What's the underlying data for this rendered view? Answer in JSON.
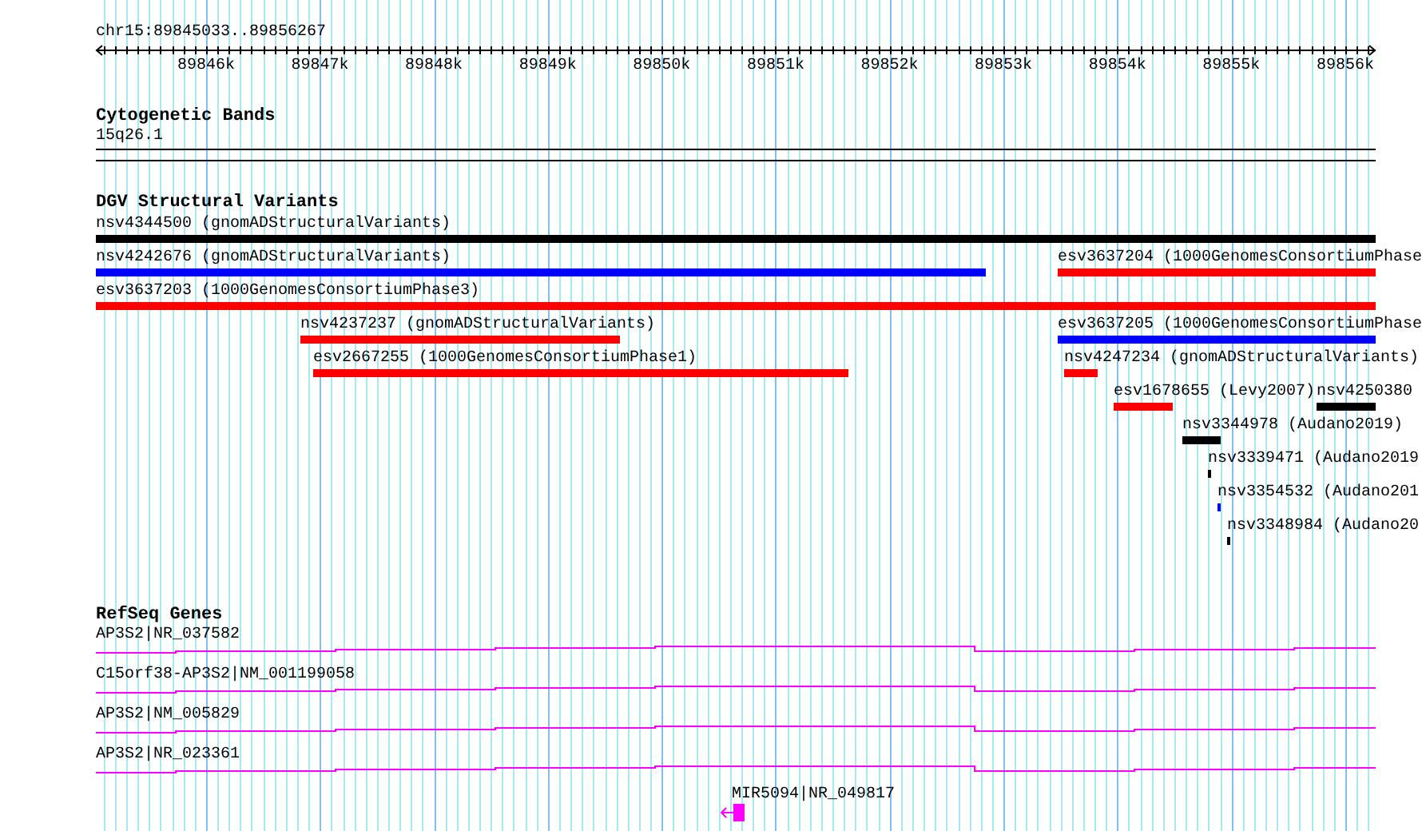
{
  "ruler": {
    "location": "chr15:89845033..89856267",
    "ticks": [
      {
        "label": "89846k"
      },
      {
        "label": "89847k"
      },
      {
        "label": "89848k"
      },
      {
        "label": "89849k"
      },
      {
        "label": "89850k"
      },
      {
        "label": "89851k"
      },
      {
        "label": "89852k"
      },
      {
        "label": "89853k"
      },
      {
        "label": "89854k"
      },
      {
        "label": "89855k"
      },
      {
        "label": "89856k"
      }
    ]
  },
  "cytogenetic_bands": {
    "title": "Cytogenetic Bands",
    "band": {
      "label": "15q26.1"
    }
  },
  "dgv_structural_variants": {
    "title": "DGV Structural Variants",
    "rows": [
      [
        {
          "label": "nsv4344500 (gnomADStructuralVariants)",
          "color": "#000000"
        }
      ],
      [
        {
          "label": "nsv4242676 (gnomADStructuralVariants)",
          "color": "#0000ff"
        },
        {
          "label": "esv3637204 (1000GenomesConsortiumPhase",
          "color": "#ff0000"
        }
      ],
      [
        {
          "label": "esv3637203 (1000GenomesConsortiumPhase3)",
          "color": "#ff0000"
        }
      ],
      [
        {
          "label": "nsv4237237 (gnomADStructuralVariants)",
          "color": "#ff0000"
        },
        {
          "label": "esv3637205 (1000GenomesConsortiumPhase",
          "color": "#0000ff"
        }
      ],
      [
        {
          "label": "esv2667255 (1000GenomesConsortiumPhase1)",
          "color": "#ff0000"
        },
        {
          "label": "nsv4247234 (gnomADStructuralVariants)",
          "color": "#ff0000"
        }
      ],
      [
        {
          "label": "esv1678655 (Levy2007)",
          "color": "#ff0000"
        },
        {
          "label": "nsv4250380",
          "color": "#000000"
        }
      ],
      [
        {
          "label": "nsv3344978 (Audano2019)",
          "color": "#000000"
        }
      ],
      [
        {
          "label": "nsv3339471 (Audano2019",
          "color": "#000000"
        }
      ],
      [
        {
          "label": "nsv3354532 (Audano201",
          "color": "#0000ff"
        }
      ],
      [
        {
          "label": "nsv3348984 (Audano20",
          "color": "#000000"
        }
      ]
    ]
  },
  "refseq_genes": {
    "title": "RefSeq Genes",
    "genes": [
      {
        "kind": "transcript",
        "label": "AP3S2|NR_037582"
      },
      {
        "kind": "transcript",
        "label": "C15orf38-AP3S2|NM_001199058"
      },
      {
        "kind": "transcript",
        "label": "AP3S2|NM_005829"
      },
      {
        "kind": "transcript",
        "label": "AP3S2|NR_023361"
      },
      {
        "kind": "mirna",
        "label": "MIR5094|NR_049817"
      }
    ]
  }
}
